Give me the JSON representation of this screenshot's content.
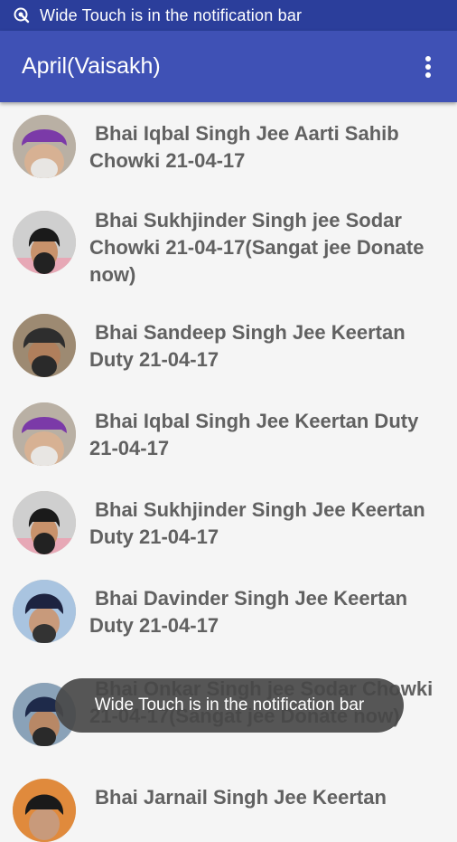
{
  "status_bar": {
    "text": "Wide Touch is in the notification bar",
    "icon": "touch-icon"
  },
  "app_bar": {
    "title": "April(Vaisakh)",
    "menu_icon": "more-vert-icon"
  },
  "items": [
    {
      "title": " Bhai Iqbal Singh Jee Aarti Sahib Chowki 21-04-17",
      "avatar": "turban-purple"
    },
    {
      "title": " Bhai Sukhjinder Singh jee Sodar Chowki 21-04-17(Sangat jee Donate now)",
      "avatar": "turban-black"
    },
    {
      "title": " Bhai Sandeep Singh Jee Keertan Duty 21-04-17",
      "avatar": "turban-black"
    },
    {
      "title": " Bhai Iqbal Singh Jee Keertan Duty 21-04-17",
      "avatar": "turban-purple"
    },
    {
      "title": " Bhai Sukhjinder Singh Jee Keertan Duty 21-04-17",
      "avatar": "turban-black"
    },
    {
      "title": " Bhai Davinder Singh Jee Keertan Duty 21-04-17",
      "avatar": "turban-navy"
    },
    {
      "title": " Bhai Onkar Singh jee Sodar Chowki 21-04-17(Sangat jee Donate now)",
      "avatar": "turban-navy"
    },
    {
      "title": " Bhai Jarnail Singh Jee Keertan",
      "avatar": "turban-black-orange"
    }
  ],
  "toast": {
    "text": "Wide Touch is in the notification bar"
  },
  "colors": {
    "status_bar": "#2b3e9b",
    "app_bar": "#3f51b5",
    "text": "#616161",
    "background": "#f5f5f5"
  }
}
